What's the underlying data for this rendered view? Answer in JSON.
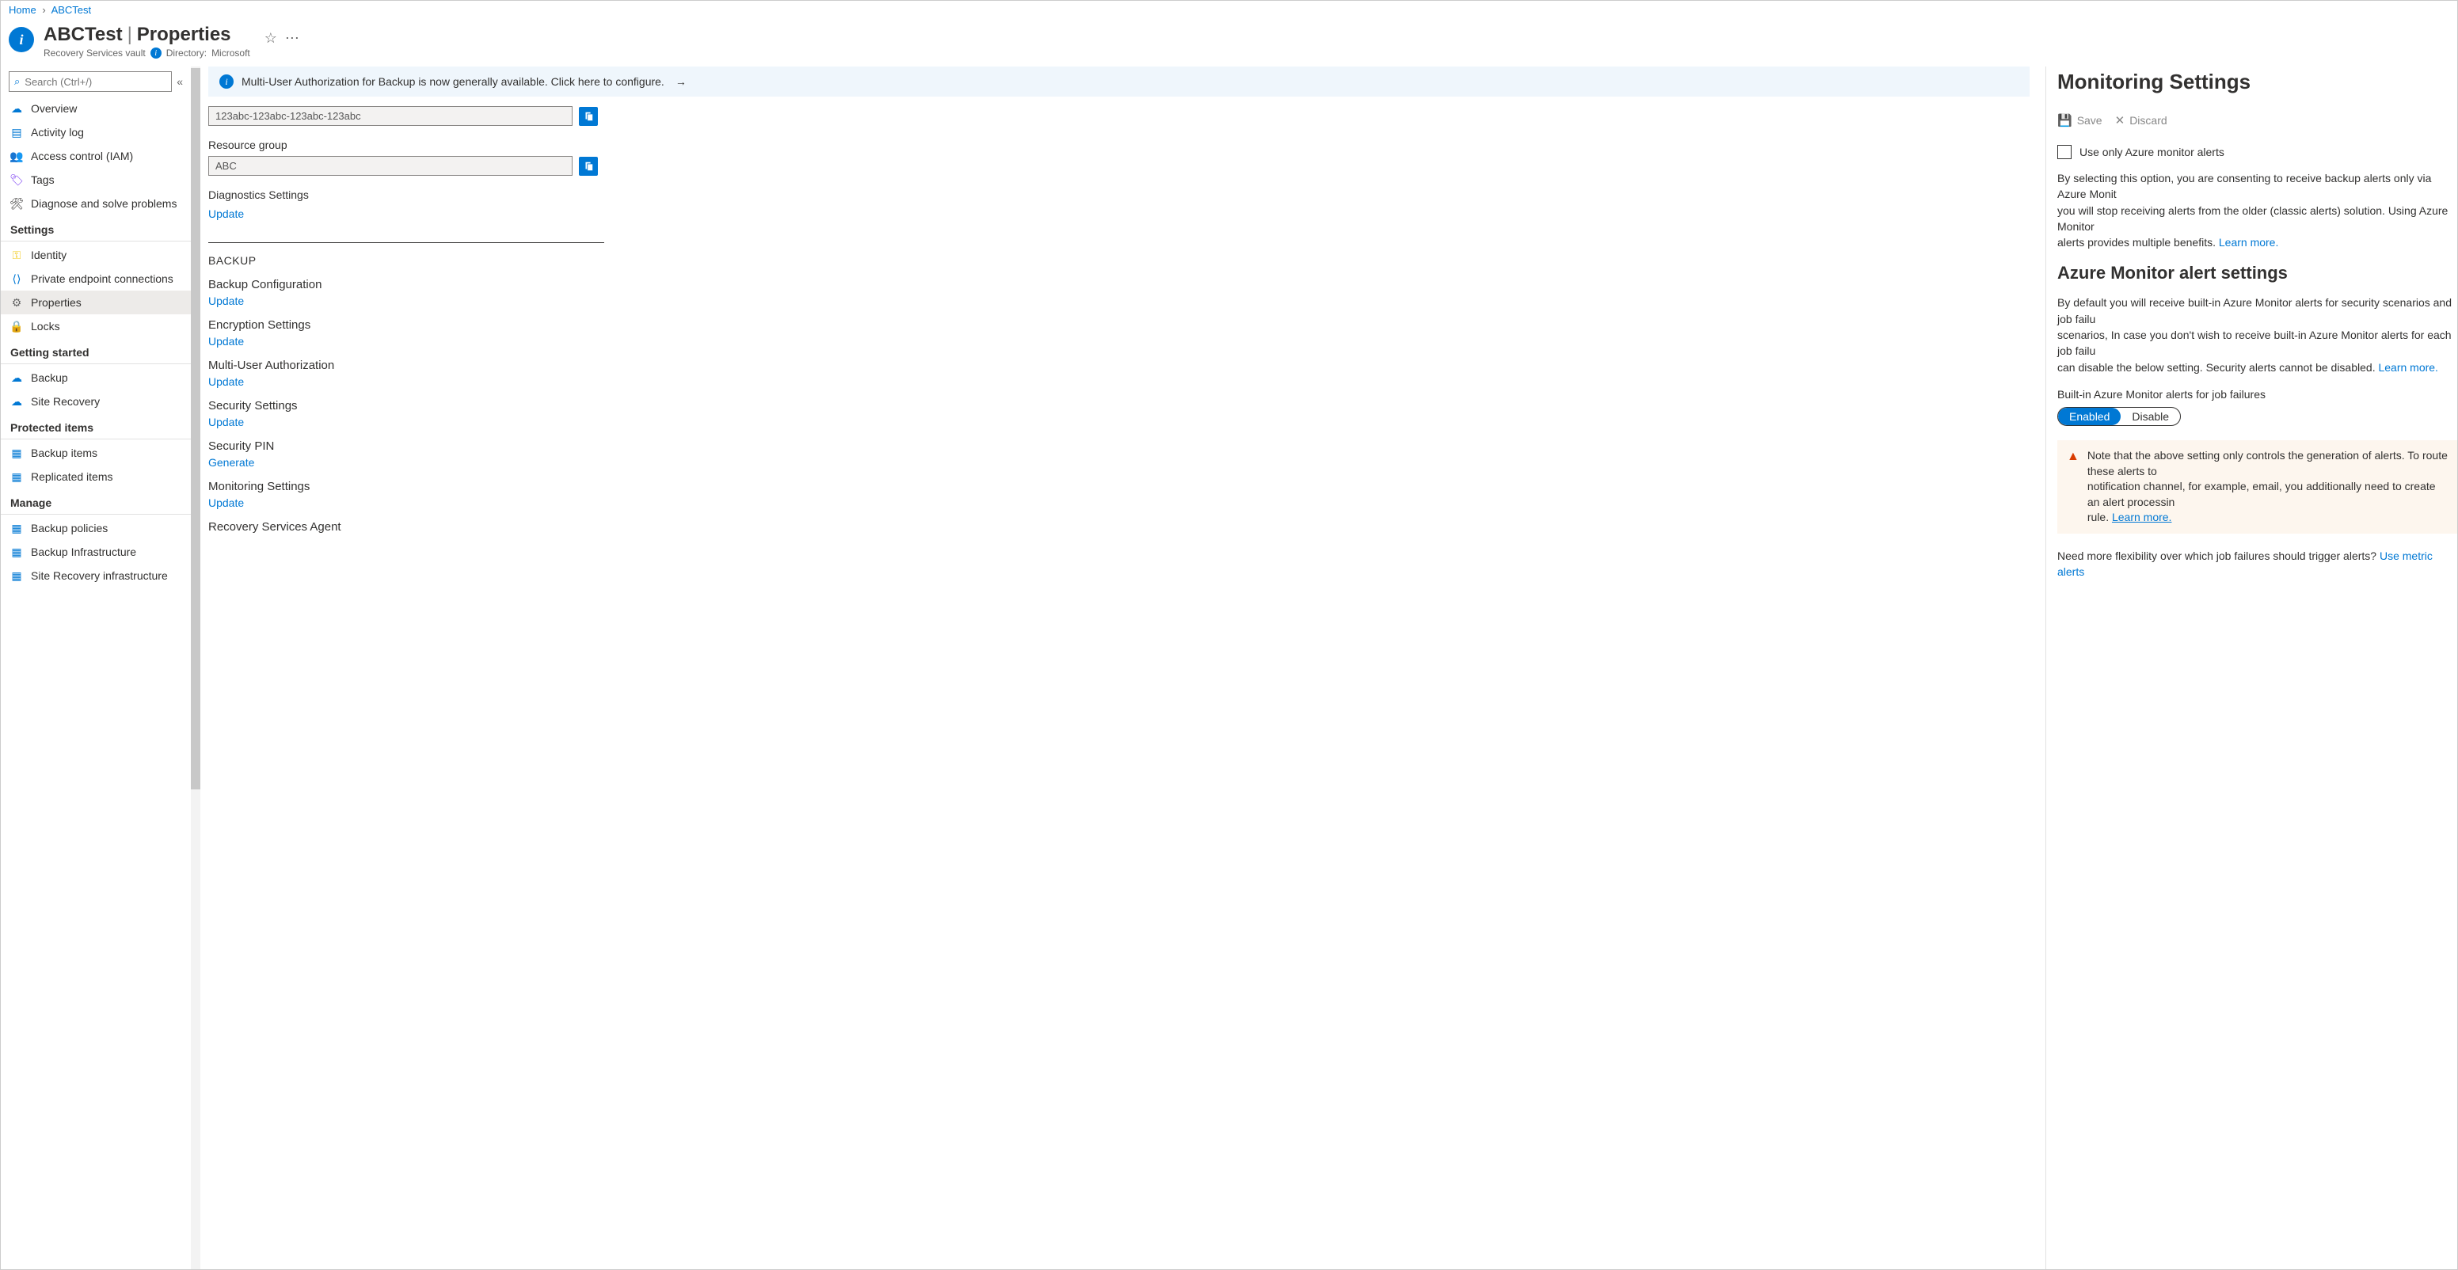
{
  "breadcrumb": {
    "home": "Home",
    "current": "ABCTest"
  },
  "header": {
    "resource": "ABCTest",
    "page": "Properties",
    "subtitle": "Recovery Services vault",
    "directory_label": "Directory:",
    "directory_value": "Microsoft"
  },
  "search": {
    "placeholder": "Search (Ctrl+/)"
  },
  "nav": {
    "top": [
      {
        "label": "Overview"
      },
      {
        "label": "Activity log"
      },
      {
        "label": "Access control (IAM)"
      },
      {
        "label": "Tags"
      },
      {
        "label": "Diagnose and solve problems"
      }
    ],
    "groups": [
      {
        "title": "Settings",
        "items": [
          {
            "label": "Identity"
          },
          {
            "label": "Private endpoint connections"
          },
          {
            "label": "Properties",
            "active": true
          },
          {
            "label": "Locks"
          }
        ]
      },
      {
        "title": "Getting started",
        "items": [
          {
            "label": "Backup"
          },
          {
            "label": "Site Recovery"
          }
        ]
      },
      {
        "title": "Protected items",
        "items": [
          {
            "label": "Backup items"
          },
          {
            "label": "Replicated items"
          }
        ]
      },
      {
        "title": "Manage",
        "items": [
          {
            "label": "Backup policies"
          },
          {
            "label": "Backup Infrastructure"
          },
          {
            "label": "Site Recovery infrastructure"
          }
        ]
      }
    ]
  },
  "banner": {
    "text": "Multi-User Authorization for Backup is now generally available. Click here to configure."
  },
  "fields": {
    "id_value": "123abc-123abc-123abc-123abc",
    "rg_label": "Resource group",
    "rg_value": "ABC",
    "diag_label": "Diagnostics Settings",
    "update": "Update",
    "generate": "Generate"
  },
  "backup_section": {
    "title": "BACKUP",
    "items": [
      {
        "title": "Backup Configuration",
        "action": "Update"
      },
      {
        "title": "Encryption Settings",
        "action": "Update"
      },
      {
        "title": "Multi-User Authorization",
        "action": "Update"
      },
      {
        "title": "Security Settings",
        "action": "Update"
      },
      {
        "title": "Security PIN",
        "action": "Generate"
      },
      {
        "title": "Monitoring Settings",
        "action": "Update"
      },
      {
        "title": "Recovery Services Agent",
        "action": ""
      }
    ]
  },
  "panel": {
    "title": "Monitoring Settings",
    "save": "Save",
    "discard": "Discard",
    "checkbox_label": "Use only Azure monitor alerts",
    "para1_a": "By selecting this option, you are consenting to receive backup alerts only via Azure Monit",
    "para1_b": "you will stop receiving alerts from the older (classic alerts) solution. Using Azure Monitor ",
    "para1_c": "alerts provides multiple benefits. ",
    "learn_more": "Learn more.",
    "h2": "Azure Monitor alert settings",
    "para2_a": "By default you will receive built-in Azure Monitor alerts for security scenarios and job failu",
    "para2_b": "scenarios, In case you don't wish to receive built-in Azure Monitor alerts for each job failu",
    "para2_c": "can disable the below setting. Security alerts cannot be disabled. ",
    "toggle_label": "Built-in Azure Monitor alerts for job failures",
    "toggle_on": "Enabled",
    "toggle_off": "Disable",
    "warn_a": "Note that the above setting only controls the generation of alerts. To route these alerts to",
    "warn_b": "notification channel, for example, email, you additionally need to create an alert processin",
    "warn_c": "rule. ",
    "flex_text": "Need more flexibility over which job failures should trigger alerts? ",
    "flex_link": "Use metric alerts"
  }
}
